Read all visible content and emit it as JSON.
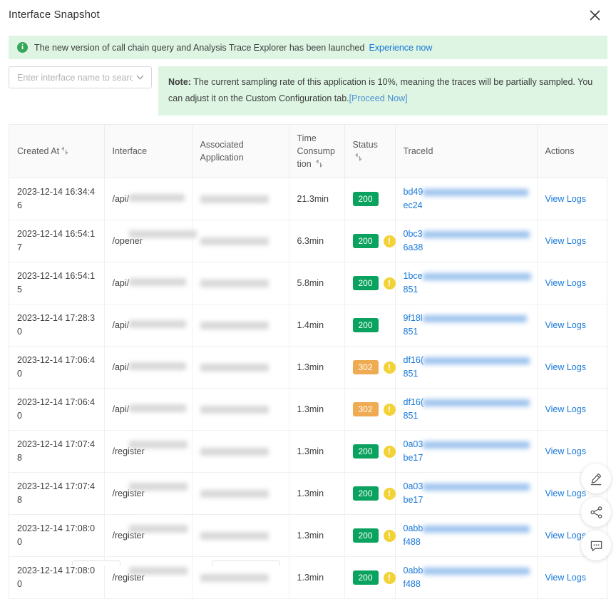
{
  "header": {
    "title": "Interface Snapshot",
    "close_icon": "close-icon"
  },
  "info_banner": {
    "icon": "info-circle-icon",
    "text": "The new version of call chain query and Analysis Trace Explorer has been launched",
    "link_label": "Experience now"
  },
  "search": {
    "placeholder": "Enter interface name to search",
    "value": "",
    "chevron_icon": "chevron-down-icon"
  },
  "note_banner": {
    "label": "Note:",
    "text": " The current sampling rate of this application is 10%, meaning the traces will be partially sampled. You can adjust it on the Custom Configuration tab.",
    "link_label": "[Proceed Now]"
  },
  "table": {
    "columns": [
      {
        "label": "Created At",
        "sortable": true
      },
      {
        "label": "Interface",
        "sortable": false
      },
      {
        "label": "Associated Application",
        "sortable": false
      },
      {
        "label": "Time Consumption",
        "sortable": true
      },
      {
        "label": "Status",
        "sortable": true
      },
      {
        "label": "TraceId",
        "sortable": false
      },
      {
        "label": "Actions",
        "sortable": false
      }
    ],
    "action_label": "View Logs",
    "rows": [
      {
        "created_at": "2023-12-14 16:34:46",
        "interface": "/api/",
        "interface_redacted": true,
        "application_redacted": true,
        "time_consumption": "21.3min",
        "status_code": "200",
        "status_type": "success",
        "has_warning": false,
        "trace_prefix": "bd49",
        "trace_suffix": "ec24",
        "trace_redacted": true
      },
      {
        "created_at": "2023-12-14 16:54:17",
        "interface": "/open­er",
        "interface_redacted": true,
        "application_redacted": true,
        "time_consumption": "6.3min",
        "status_code": "200",
        "status_type": "success",
        "has_warning": true,
        "trace_prefix": "0bc3",
        "trace_suffix": "6a38",
        "trace_redacted": true
      },
      {
        "created_at": "2023-12-14 16:54:15",
        "interface": "/api/",
        "interface_redacted": true,
        "application_redacted": true,
        "time_consumption": "5.8min",
        "status_code": "200",
        "status_type": "success",
        "has_warning": true,
        "trace_prefix": "1bce",
        "trace_suffix": "851",
        "trace_redacted": true
      },
      {
        "created_at": "2023-12-14 17:28:30",
        "interface": "/api/",
        "interface_redacted": true,
        "application_redacted": true,
        "time_consumption": "1.4min",
        "status_code": "200",
        "status_type": "success",
        "has_warning": false,
        "trace_prefix": "9f18l",
        "trace_suffix": "851",
        "trace_redacted": true
      },
      {
        "created_at": "2023-12-14 17:06:40",
        "interface": "/api/",
        "interface_redacted": true,
        "application_redacted": true,
        "time_consumption": "1.3min",
        "status_code": "302",
        "status_type": "redirect",
        "has_warning": true,
        "trace_prefix": "df16(",
        "trace_suffix": "851",
        "trace_redacted": true
      },
      {
        "created_at": "2023-12-14 17:06:40",
        "interface": "/api/",
        "interface_redacted": true,
        "application_redacted": true,
        "time_consumption": "1.3min",
        "status_code": "302",
        "status_type": "redirect",
        "has_warning": true,
        "trace_prefix": "df16(",
        "trace_suffix": "851",
        "trace_redacted": true
      },
      {
        "created_at": "2023-12-14 17:07:48",
        "interface": "/regis­ter",
        "interface_redacted": true,
        "application_redacted": true,
        "time_consumption": "1.3min",
        "status_code": "200",
        "status_type": "success",
        "has_warning": true,
        "trace_prefix": "0a03",
        "trace_suffix": "be17",
        "trace_redacted": true
      },
      {
        "created_at": "2023-12-14 17:07:48",
        "interface": "/regis­ter",
        "interface_redacted": true,
        "application_redacted": true,
        "time_consumption": "1.3min",
        "status_code": "200",
        "status_type": "success",
        "has_warning": true,
        "trace_prefix": "0a03",
        "trace_suffix": "be17",
        "trace_redacted": true
      },
      {
        "created_at": "2023-12-14 17:08:00",
        "interface": "/regis­ter",
        "interface_redacted": true,
        "application_redacted": true,
        "time_consumption": "1.3min",
        "status_code": "200",
        "status_type": "success",
        "has_warning": true,
        "trace_prefix": "0abb",
        "trace_suffix": "f488",
        "trace_redacted": true
      },
      {
        "created_at": "2023-12-14 17:08:00",
        "interface": "/regis­ter",
        "interface_redacted": true,
        "application_redacted": true,
        "time_consumption": "1.3min",
        "status_code": "200",
        "status_type": "success",
        "has_warning": true,
        "trace_prefix": "0abb",
        "trace_suffix": "f488",
        "trace_redacted": true
      }
    ]
  },
  "fab": [
    {
      "icon": "pencil-edit-icon"
    },
    {
      "icon": "share-icon"
    },
    {
      "icon": "feedback-chat-icon"
    }
  ],
  "colors": {
    "banner_green": "#ddf5e2",
    "status_success": "#0aa25f",
    "status_redirect": "#efab52",
    "warning_yellow": "#f2d235",
    "link_blue": "#1677d9"
  }
}
